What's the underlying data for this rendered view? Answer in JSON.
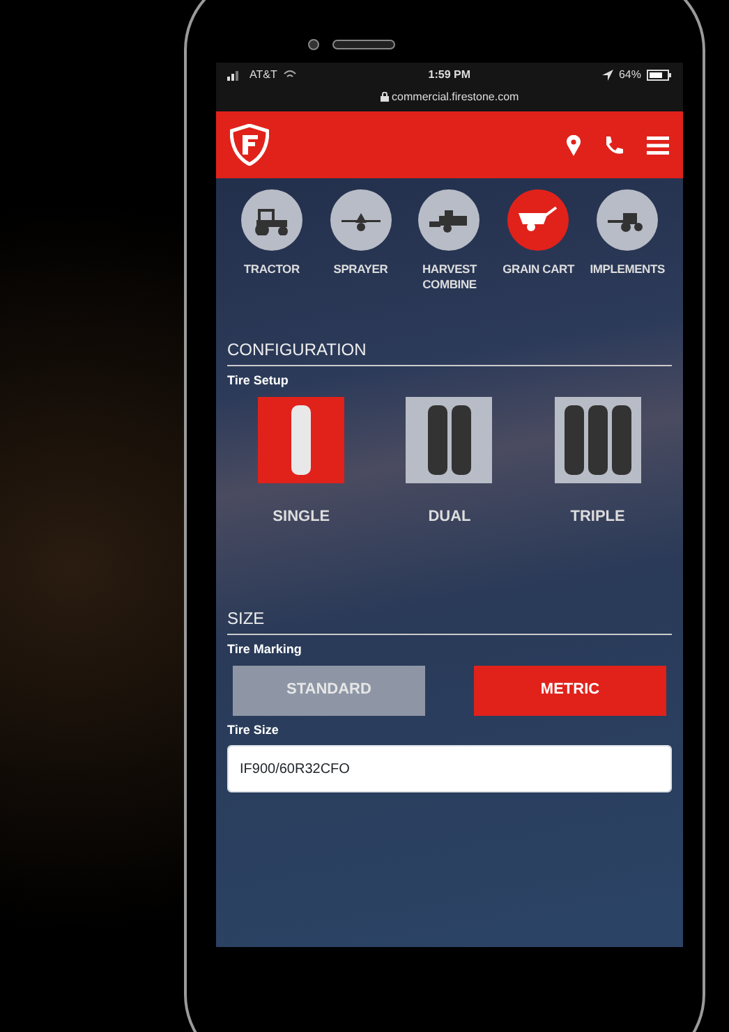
{
  "status_bar": {
    "carrier": "AT&T",
    "time": "1:59 PM",
    "battery": "64%",
    "url": "commercial.firestone.com"
  },
  "categories": [
    {
      "label": "TRACTOR",
      "kind": "tractor",
      "selected": false
    },
    {
      "label": "SPRAYER",
      "kind": "sprayer",
      "selected": false
    },
    {
      "label": "HARVEST COMBINE",
      "kind": "combine",
      "selected": false
    },
    {
      "label": "GRAIN CART",
      "kind": "cart",
      "selected": true
    },
    {
      "label": "IMPLEMENTS",
      "kind": "implement",
      "selected": false
    }
  ],
  "configuration": {
    "heading": "CONFIGURATION",
    "label": "Tire Setup",
    "options": [
      {
        "label": "SINGLE",
        "kind": "single",
        "selected": true
      },
      {
        "label": "DUAL",
        "kind": "dual",
        "selected": false
      },
      {
        "label": "TRIPLE",
        "kind": "triple",
        "selected": false
      }
    ]
  },
  "size": {
    "heading": "SIZE",
    "marking_label": "Tire Marking",
    "markings": [
      {
        "label": "STANDARD",
        "selected": false
      },
      {
        "label": "METRIC",
        "selected": true
      }
    ],
    "size_label": "Tire Size",
    "size_value": "IF900/60R32CFO"
  }
}
